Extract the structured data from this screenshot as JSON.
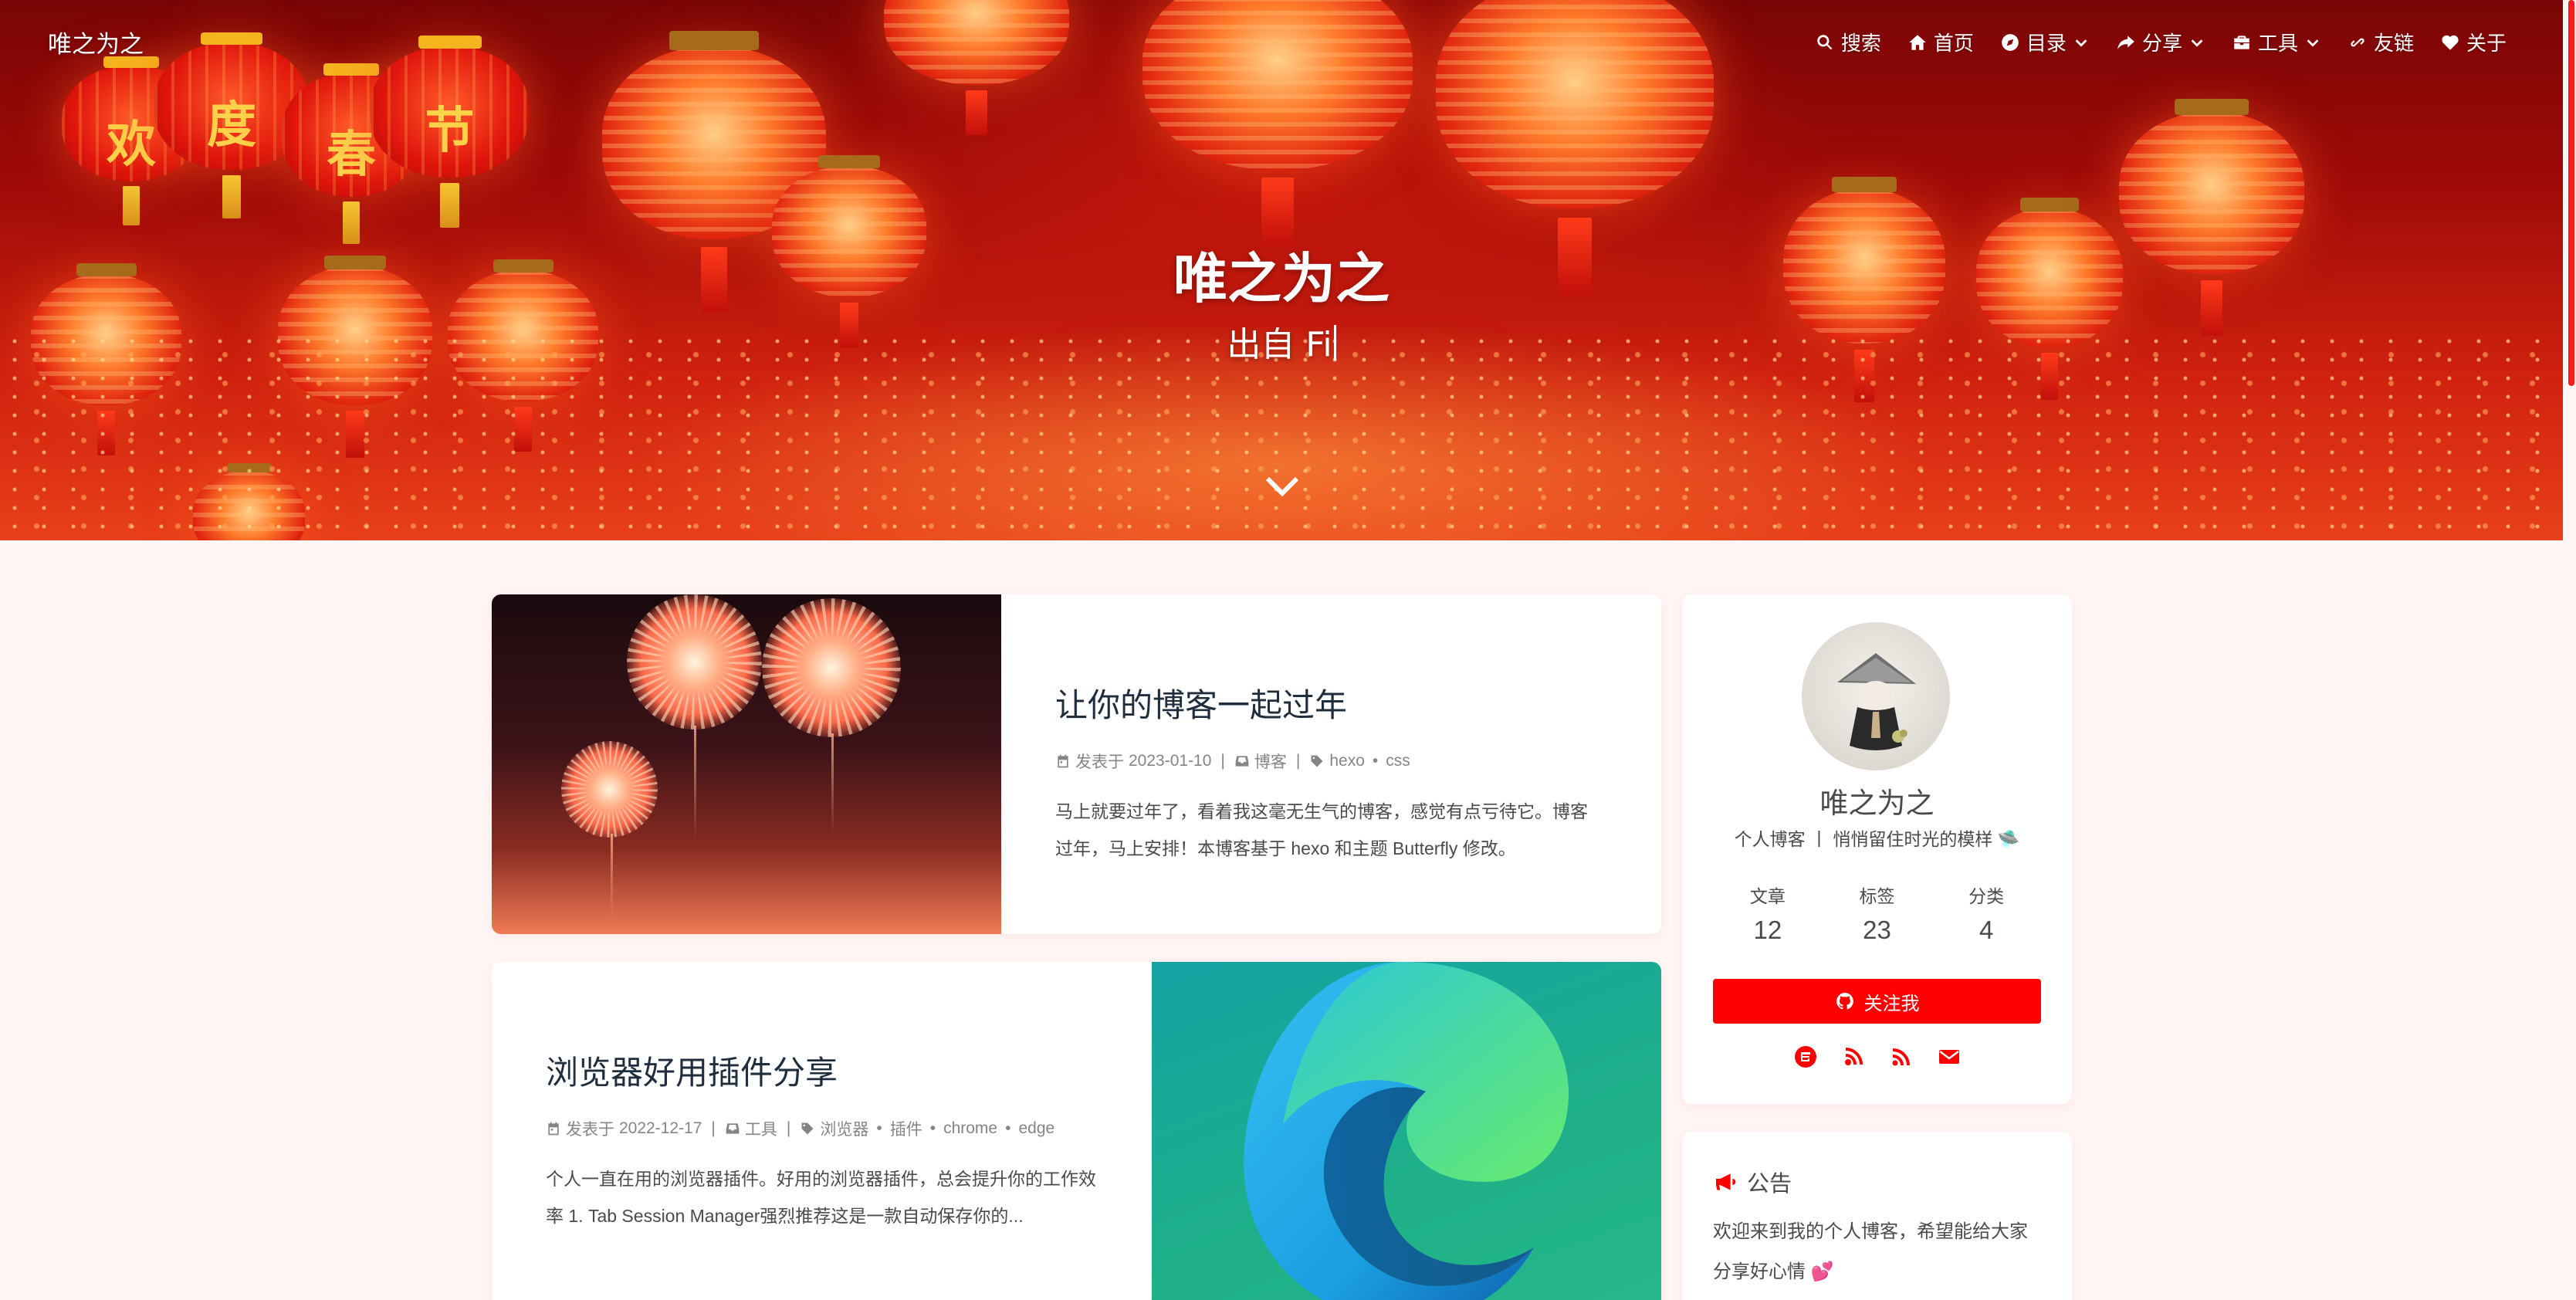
{
  "header": {
    "brand": "唯之为之",
    "title": "唯之为之",
    "subtitle": "出自 Fi"
  },
  "nav": {
    "items": [
      {
        "label": "搜索",
        "icon": "search-icon"
      },
      {
        "label": "首页",
        "icon": "home-icon"
      },
      {
        "label": "目录",
        "icon": "compass-icon",
        "dropdown": true
      },
      {
        "label": "分享",
        "icon": "share-icon",
        "dropdown": true
      },
      {
        "label": "工具",
        "icon": "toolbox-icon",
        "dropdown": true
      },
      {
        "label": "友链",
        "icon": "link-icon"
      },
      {
        "label": "关于",
        "icon": "heart-icon"
      }
    ]
  },
  "lantern_glyphs": [
    "欢",
    "度",
    "春",
    "节"
  ],
  "posts": [
    {
      "title": "让你的博客一起过年",
      "posted_label": "发表于",
      "date": "2023-01-10",
      "category": "博客",
      "tags": [
        "hexo",
        "css"
      ],
      "excerpt": "马上就要过年了，看着我这毫无生气的博客，感觉有点亏待它。博客过年，马上安排！本博客基于 hexo 和主题 Butterfly 修改。"
    },
    {
      "title": "浏览器好用插件分享",
      "posted_label": "发表于",
      "date": "2022-12-17",
      "category": "工具",
      "tags": [
        "浏览器",
        "插件",
        "chrome",
        "edge"
      ],
      "excerpt": "个人一直在用的浏览器插件。好用的浏览器插件，总会提升你的工作效率 1. Tab Session Manager强烈推荐这是一款自动保存你的..."
    }
  ],
  "author": {
    "name": "唯之为之",
    "description": "个人博客 丨 悄悄留住时光的模样 🛸",
    "stats": [
      {
        "label": "文章",
        "value": "12"
      },
      {
        "label": "标签",
        "value": "23"
      },
      {
        "label": "分类",
        "value": "4"
      }
    ],
    "follow_label": "关注我",
    "socials": [
      "gitee-icon",
      "blog-icon",
      "rss-icon",
      "envelope-icon"
    ]
  },
  "notice": {
    "title": "公告",
    "text": "欢迎来到我的个人博客，希望能给大家分享好心情 💕"
  },
  "colors": {
    "accent": "#ff0000",
    "page_bg": "#fff6f5",
    "text": "#4c4948",
    "title": "#1f2d3d",
    "meta": "#858585"
  }
}
